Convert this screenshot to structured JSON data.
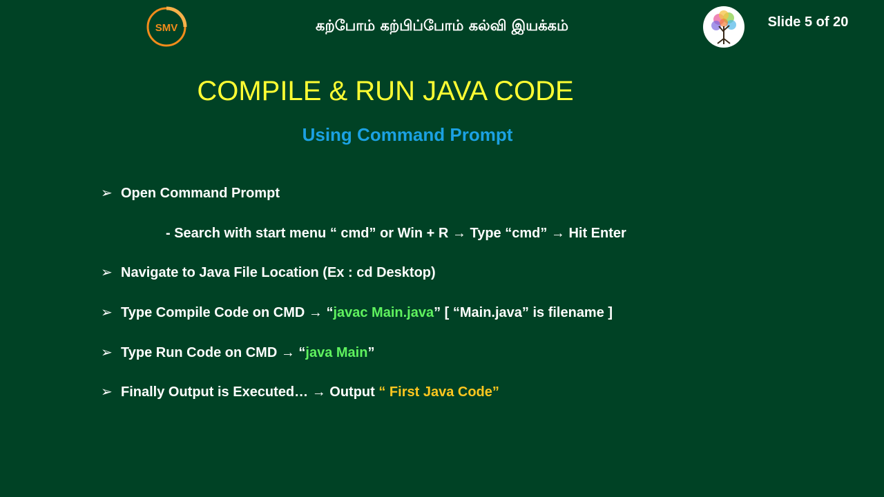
{
  "header": {
    "logo_text": "SMV",
    "tamil_title": "கற்போம் கற்பிப்போம் கல்வி இயக்கம்",
    "slide_counter": "Slide 5 of 20"
  },
  "slide": {
    "title": "COMPILE & RUN JAVA CODE",
    "subtitle": "Using Command Prompt",
    "bullet_marker": "➢",
    "arrow": "→",
    "bullets": [
      {
        "text": "Open Command Prompt"
      },
      {
        "sub_parts": {
          "a": "- Search with start menu “ cmd” or Win + R",
          "b": "Type “cmd”",
          "c": "Hit Enter"
        }
      },
      {
        "text": "Navigate to Java File Location (Ex : cd Desktop)"
      },
      {
        "parts": {
          "a": "Type Compile Code  on CMD",
          "b": "“",
          "code": "javac Main.java",
          "c": "” [ “Main.java”  is filename ]"
        }
      },
      {
        "parts": {
          "a": "Type Run Code on CMD",
          "b": "“",
          "code": "java Main",
          "c": "”"
        }
      },
      {
        "parts": {
          "a": "Finally Output is Executed…",
          "b": "Output",
          "output": "“ First Java Code”"
        }
      }
    ]
  },
  "colors": {
    "background": "#004225",
    "title": "#ffff33",
    "subtitle": "#1ba1e2",
    "code": "#5ff25f",
    "output": "#ffc71f",
    "logo_orange": "#f28c1b"
  },
  "icons": {
    "logo_left": "smv-logo-icon",
    "logo_right": "colorful-tree-logo-icon"
  }
}
